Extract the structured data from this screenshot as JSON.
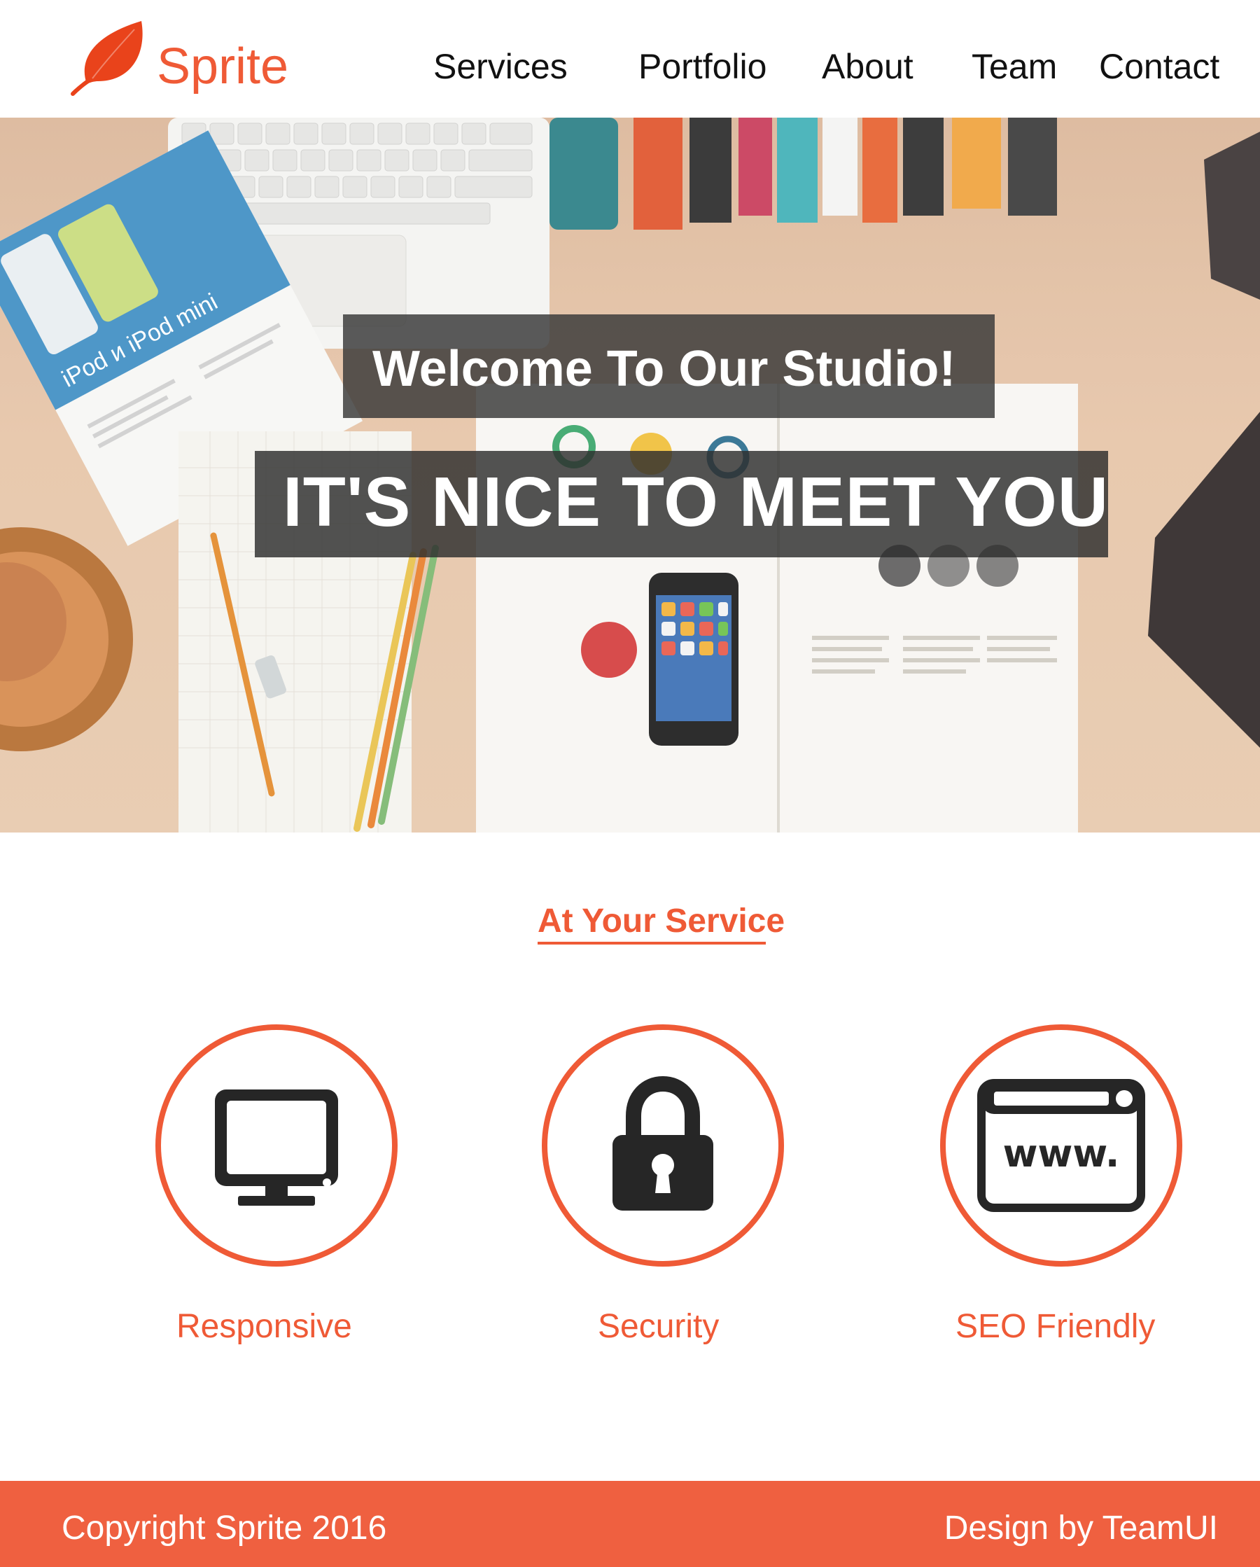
{
  "brand": {
    "name": "Sprite",
    "logo_icon": "leaf-icon",
    "accent_color": "#ef5a36"
  },
  "nav": {
    "items": [
      "Services",
      "Portfolio",
      "About",
      "Team",
      "Contact"
    ]
  },
  "hero": {
    "title": "Welcome To Our Studio!",
    "subtitle": "IT'S NICE TO MEET YOU"
  },
  "services": {
    "heading": "At Your Service",
    "items": [
      {
        "label": "Responsive",
        "icon": "monitor-icon"
      },
      {
        "label": "Security",
        "icon": "lock-icon"
      },
      {
        "label": "SEO Friendly",
        "icon": "browser-www-icon"
      }
    ]
  },
  "footer": {
    "copyright": "Copyright Sprite 2016",
    "credit": "Design by TeamUI",
    "background_color": "#ef6040"
  }
}
